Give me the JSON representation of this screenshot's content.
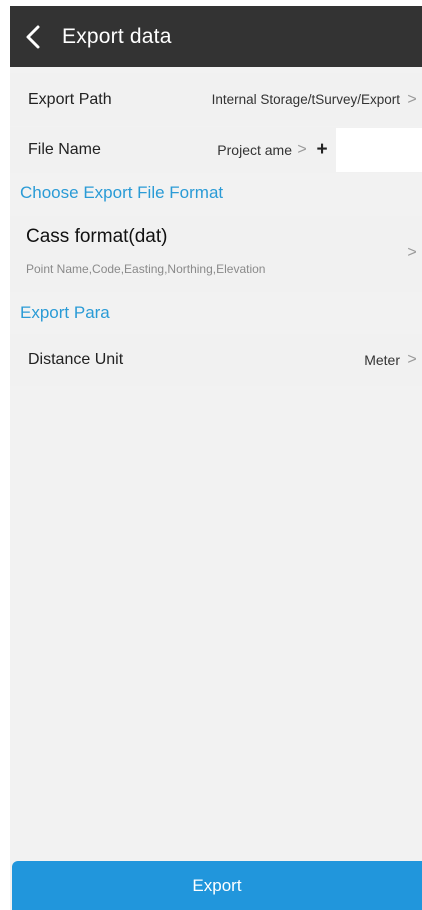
{
  "header": {
    "title": "Export data",
    "back_icon": "chevron-left-icon"
  },
  "export_path": {
    "label": "Export Path",
    "value": "Internal Storage/tSurvey/Export",
    "chevron": ">"
  },
  "file_name": {
    "label": "File Name",
    "value": "Project ame",
    "chevron": ">",
    "plus": "+",
    "input_value": ""
  },
  "format_section": {
    "heading": "Choose Export File Format",
    "format_title": "Cass format(dat)",
    "format_fields": "Point Name,Code,Easting,Northing,Elevation",
    "chevron": ">"
  },
  "para_section": {
    "heading": "Export Para",
    "distance_label": "Distance Unit",
    "distance_value": "Meter",
    "chevron": ">"
  },
  "footer": {
    "export_label": "Export"
  },
  "colors": {
    "titlebar": "#333333",
    "accent": "#2a9bd6",
    "button": "#2196dc",
    "background": "#f2f2f2"
  }
}
